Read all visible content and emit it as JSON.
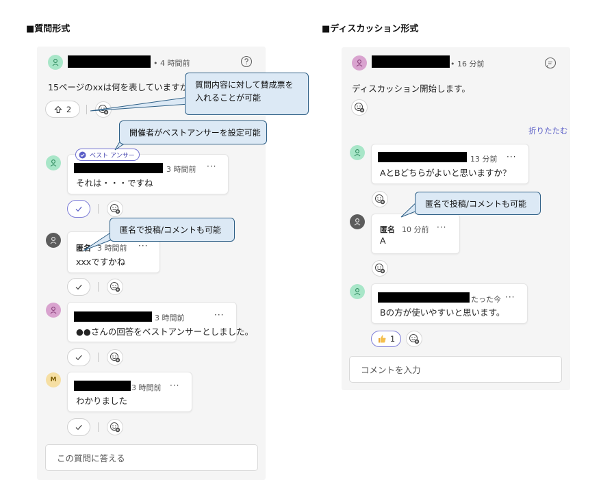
{
  "left": {
    "section_title": "■質問形式",
    "question": {
      "time": "• 4 時間前",
      "text": "15ページのxxは何を表していますか？",
      "upvote_count": "2"
    },
    "best_answer_label": "ベスト アンサー",
    "replies": [
      {
        "time": "3 時間前",
        "text": "それは・・・ですね"
      },
      {
        "author": "匿名",
        "time": "3 時間前",
        "text": "xxxですかね"
      },
      {
        "time": "3 時間前",
        "text": "●●さんの回答をベストアンサーとしました。"
      },
      {
        "avatar_initial": "M",
        "time": "3 時間前",
        "text": "わかりました"
      }
    ],
    "reply_placeholder": "この質問に答える"
  },
  "right": {
    "section_title": "■ディスカッション形式",
    "post": {
      "time": "• 16 分前",
      "text": "ディスカッション開始します。"
    },
    "collapse_label": "折りたたむ",
    "replies": [
      {
        "time": "13 分前",
        "text": "AとBどちらがよいと思いますか？"
      },
      {
        "author": "匿名",
        "time": "10 分前",
        "text": "A"
      },
      {
        "time": "たった今",
        "text": "Bの方が使いやすいと思います。",
        "reaction_count": "1"
      }
    ],
    "comment_placeholder": "コメントを入力"
  },
  "callouts": {
    "upvote": "質問内容に対して賛成票を入れることが可能",
    "best_answer": "開催者がベストアンサーを設定可能",
    "anonymous_left": "匿名で投稿/コメントも可能",
    "anonymous_right": "匿名で投稿/コメントも可能"
  },
  "more_glyph": "···",
  "colors": {
    "accent": "#6264a7",
    "callout_fill": "#dce9f5",
    "callout_border": "#2e5f86",
    "redaction": "#000000"
  },
  "icons": [
    "person-icon",
    "question-icon",
    "chat-icon",
    "upvote-arrow-icon",
    "emoji-add-icon",
    "checkmark-icon",
    "best-answer-check-icon",
    "thumbs-up-icon"
  ]
}
